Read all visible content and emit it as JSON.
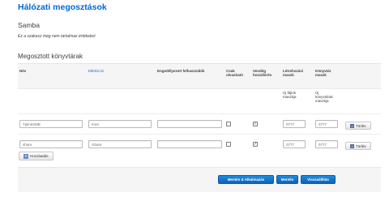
{
  "page": {
    "title": "Hálózati megosztások",
    "section": "Samba",
    "note": "Ez a szakasz még nem tartalmaz értékeket",
    "subhead": "Megosztott könyvtárak"
  },
  "table": {
    "headers": {
      "name": "Név",
      "path": "Elérési út",
      "users": "Engedélyezett felhasználók",
      "readonly_1": "Csak",
      "readonly_2": "olvasható",
      "guest_1": "Vendég",
      "guest_2": "hozzáférés",
      "createmask_1": "Létrehozási",
      "createmask_2": "maszk",
      "dirmask_1": "Könyvtár",
      "dirmask_2": "maszk"
    },
    "subrow": {
      "createmask_1": "Új fájlok",
      "createmask_2": "maszkja",
      "dirmask_1": "Új",
      "dirmask_2": "könyvtárak",
      "dirmask_3": "maszkja"
    },
    "rows": [
      {
        "name": "TplinkSMB",
        "path": "/mnt",
        "users": "",
        "readonly": false,
        "guest": true,
        "createmask": "0777",
        "dirmask": "0777"
      },
      {
        "name": "share",
        "path": "/share",
        "users": "",
        "readonly": false,
        "guest": true,
        "createmask": "0777",
        "dirmask": "0777"
      }
    ],
    "delete_label": "Törlés",
    "checkmark": "✓"
  },
  "add_label": "Hozzáadás",
  "footer": {
    "save_apply": "Mentés & Alkalmazás",
    "save": "Mentés",
    "reset": "Visszaállítás"
  },
  "icons": {
    "delete": "x-icon",
    "add": "plus-icon"
  },
  "colors": {
    "accent": "#0069d6",
    "primary_button": "#1573c9"
  }
}
